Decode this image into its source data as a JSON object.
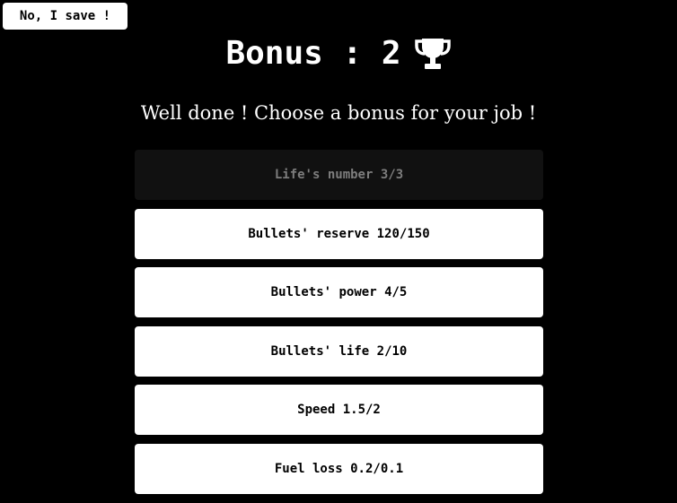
{
  "header": {
    "save_button_label": "No, I save !",
    "title": "Bonus : 2",
    "trophy_icon": "trophy-icon"
  },
  "subtitle": "Well done ! Choose a bonus for your job !",
  "options": [
    {
      "label": "Life's number 3/3",
      "disabled": true
    },
    {
      "label": "Bullets' reserve 120/150",
      "disabled": false
    },
    {
      "label": "Bullets' power 4/5",
      "disabled": false
    },
    {
      "label": "Bullets' life 2/10",
      "disabled": false
    },
    {
      "label": "Speed 1.5/2",
      "disabled": false
    },
    {
      "label": "Fuel loss 0.2/0.1",
      "disabled": false
    }
  ],
  "colors": {
    "background": "#000000",
    "button_bg": "#ffffff",
    "disabled_bg": "#111111",
    "disabled_text": "#7d7d7d"
  }
}
